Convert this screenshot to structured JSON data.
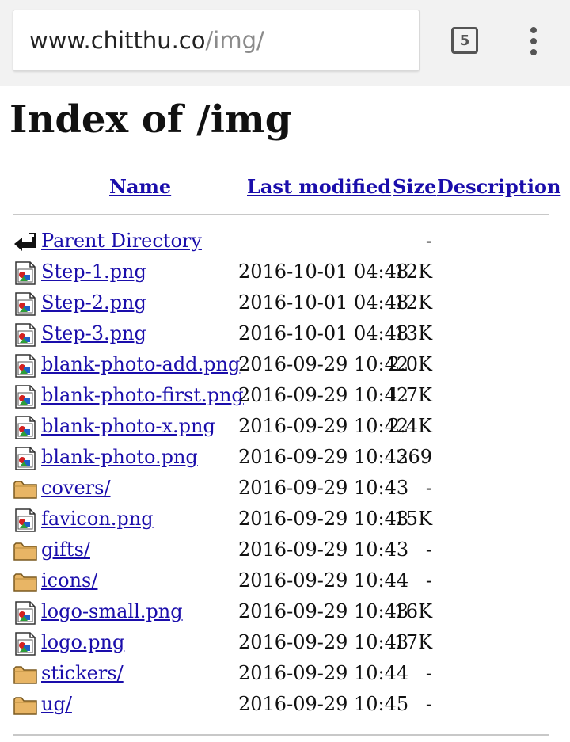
{
  "browser": {
    "url_host": "www.chitthu.co",
    "url_path": "/img/",
    "tab_count": "5"
  },
  "page": {
    "title": "Index of /img",
    "columns": {
      "name": "Name",
      "last_modified": "Last modified",
      "size": "Size",
      "description": "Description"
    },
    "entries": [
      {
        "name": "Parent Directory",
        "date": "",
        "size": "-",
        "icon": "back-arrow-icon"
      },
      {
        "name": "Step-1.png",
        "date": "2016-10-01 04:48",
        "size": "12K",
        "icon": "image-file-icon"
      },
      {
        "name": "Step-2.png",
        "date": "2016-10-01 04:48",
        "size": "12K",
        "icon": "image-file-icon"
      },
      {
        "name": "Step-3.png",
        "date": "2016-10-01 04:48",
        "size": "13K",
        "icon": "image-file-icon"
      },
      {
        "name": "blank-photo-add.png",
        "date": "2016-09-29 10:42",
        "size": "2.0K",
        "icon": "image-file-icon"
      },
      {
        "name": "blank-photo-first.png",
        "date": "2016-09-29 10:42",
        "size": "1.7K",
        "icon": "image-file-icon"
      },
      {
        "name": "blank-photo-x.png",
        "date": "2016-09-29 10:42",
        "size": "2.4K",
        "icon": "image-file-icon"
      },
      {
        "name": "blank-photo.png",
        "date": "2016-09-29 10:42",
        "size": "369",
        "icon": "image-file-icon"
      },
      {
        "name": "covers/",
        "date": "2016-09-29 10:43",
        "size": "-",
        "icon": "folder-icon"
      },
      {
        "name": "favicon.png",
        "date": "2016-09-29 10:43",
        "size": "15K",
        "icon": "image-file-icon"
      },
      {
        "name": "gifts/",
        "date": "2016-09-29 10:43",
        "size": "-",
        "icon": "folder-icon"
      },
      {
        "name": "icons/",
        "date": "2016-09-29 10:44",
        "size": "-",
        "icon": "folder-icon"
      },
      {
        "name": "logo-small.png",
        "date": "2016-09-29 10:43",
        "size": "16K",
        "icon": "image-file-icon"
      },
      {
        "name": "logo.png",
        "date": "2016-09-29 10:43",
        "size": "17K",
        "icon": "image-file-icon"
      },
      {
        "name": "stickers/",
        "date": "2016-09-29 10:44",
        "size": "-",
        "icon": "folder-icon"
      },
      {
        "name": "ug/",
        "date": "2016-09-29 10:45",
        "size": "-",
        "icon": "folder-icon"
      }
    ]
  },
  "colors": {
    "link": "#1a0dab",
    "chrome_bg": "#f2f2f2",
    "folder": "#e8b565"
  }
}
